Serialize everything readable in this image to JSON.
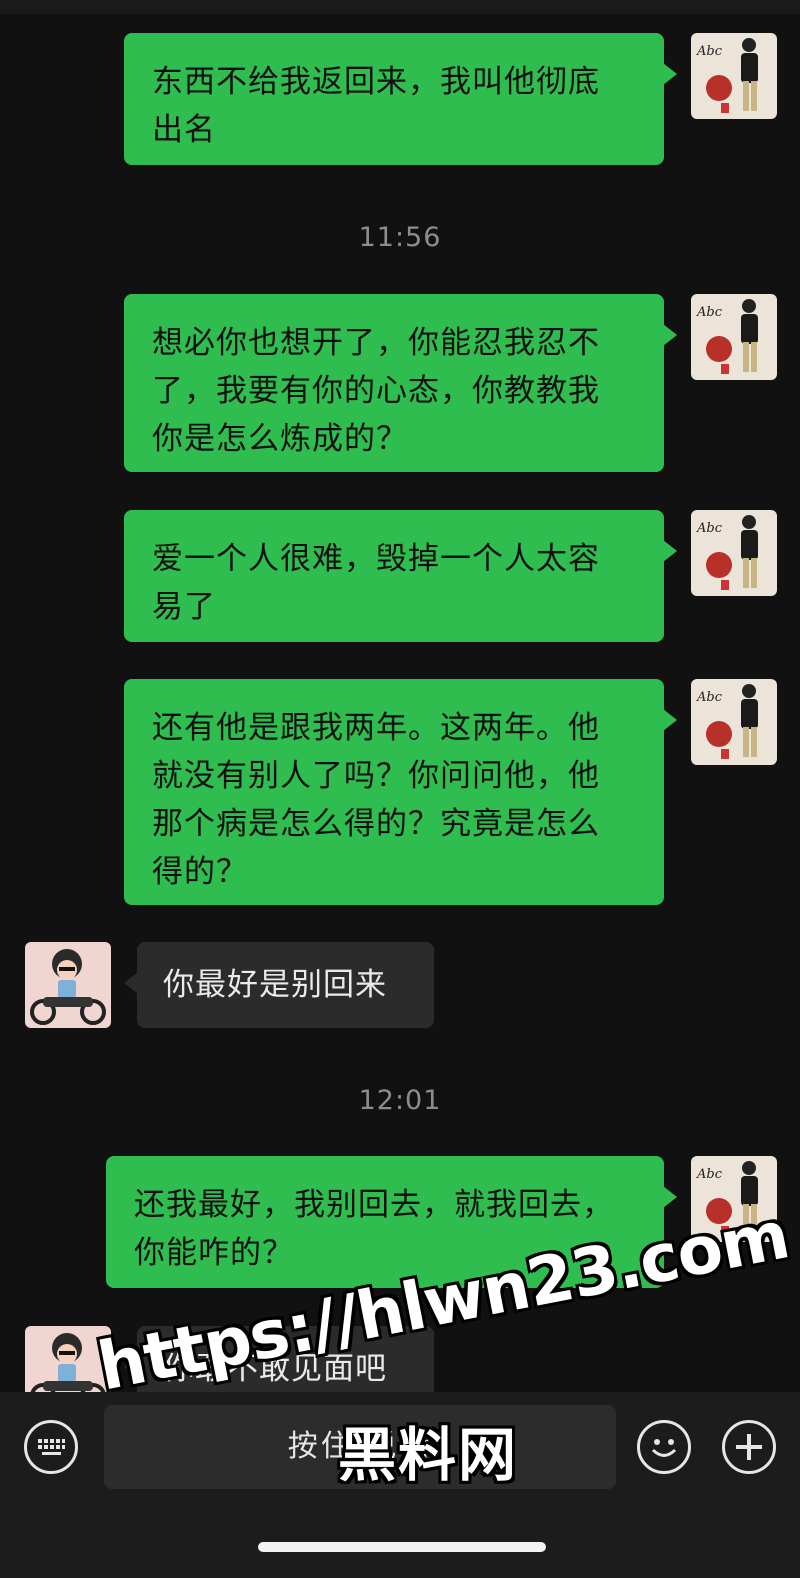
{
  "timestamps": [
    "11:56",
    "12:01"
  ],
  "messages": [
    {
      "from": "me",
      "lines": [
        "东西不给我返回来，我叫他彻底",
        "出名"
      ]
    },
    {
      "from": "me",
      "lines": [
        "想必你也想开了，你能忍我忍不",
        "了，我要有你的心态，你教教我",
        "你是怎么炼成的？"
      ]
    },
    {
      "from": "me",
      "lines": [
        "爱一个人很难，毁掉一个人太容",
        "易了"
      ]
    },
    {
      "from": "me",
      "lines": [
        "还有他是跟我两年。这两年。他",
        "就没有别人了吗？你问问他，他",
        "那个病是怎么得的？究竟是怎么",
        "得的？"
      ]
    },
    {
      "from": "them",
      "lines": [
        "你最好是别回来"
      ]
    },
    {
      "from": "me",
      "lines": [
        "还我最好，我别回去，就我回去，",
        "你能咋的？"
      ]
    },
    {
      "from": "them",
      "lines": [
        "你敢不敢见面吧"
      ]
    }
  ],
  "input_bar": {
    "hold_to_talk_label": "按住 说话",
    "keyboard_icon": "keyboard-icon",
    "emoji_icon": "emoji-icon",
    "plus_icon": "plus-icon"
  },
  "watermark": {
    "url": "https://hlwn23.com",
    "name": "黑料网"
  },
  "colors": {
    "background": "#111111",
    "outgoing_bubble": "#2fbd4f",
    "incoming_bubble": "#2b2b2b"
  }
}
